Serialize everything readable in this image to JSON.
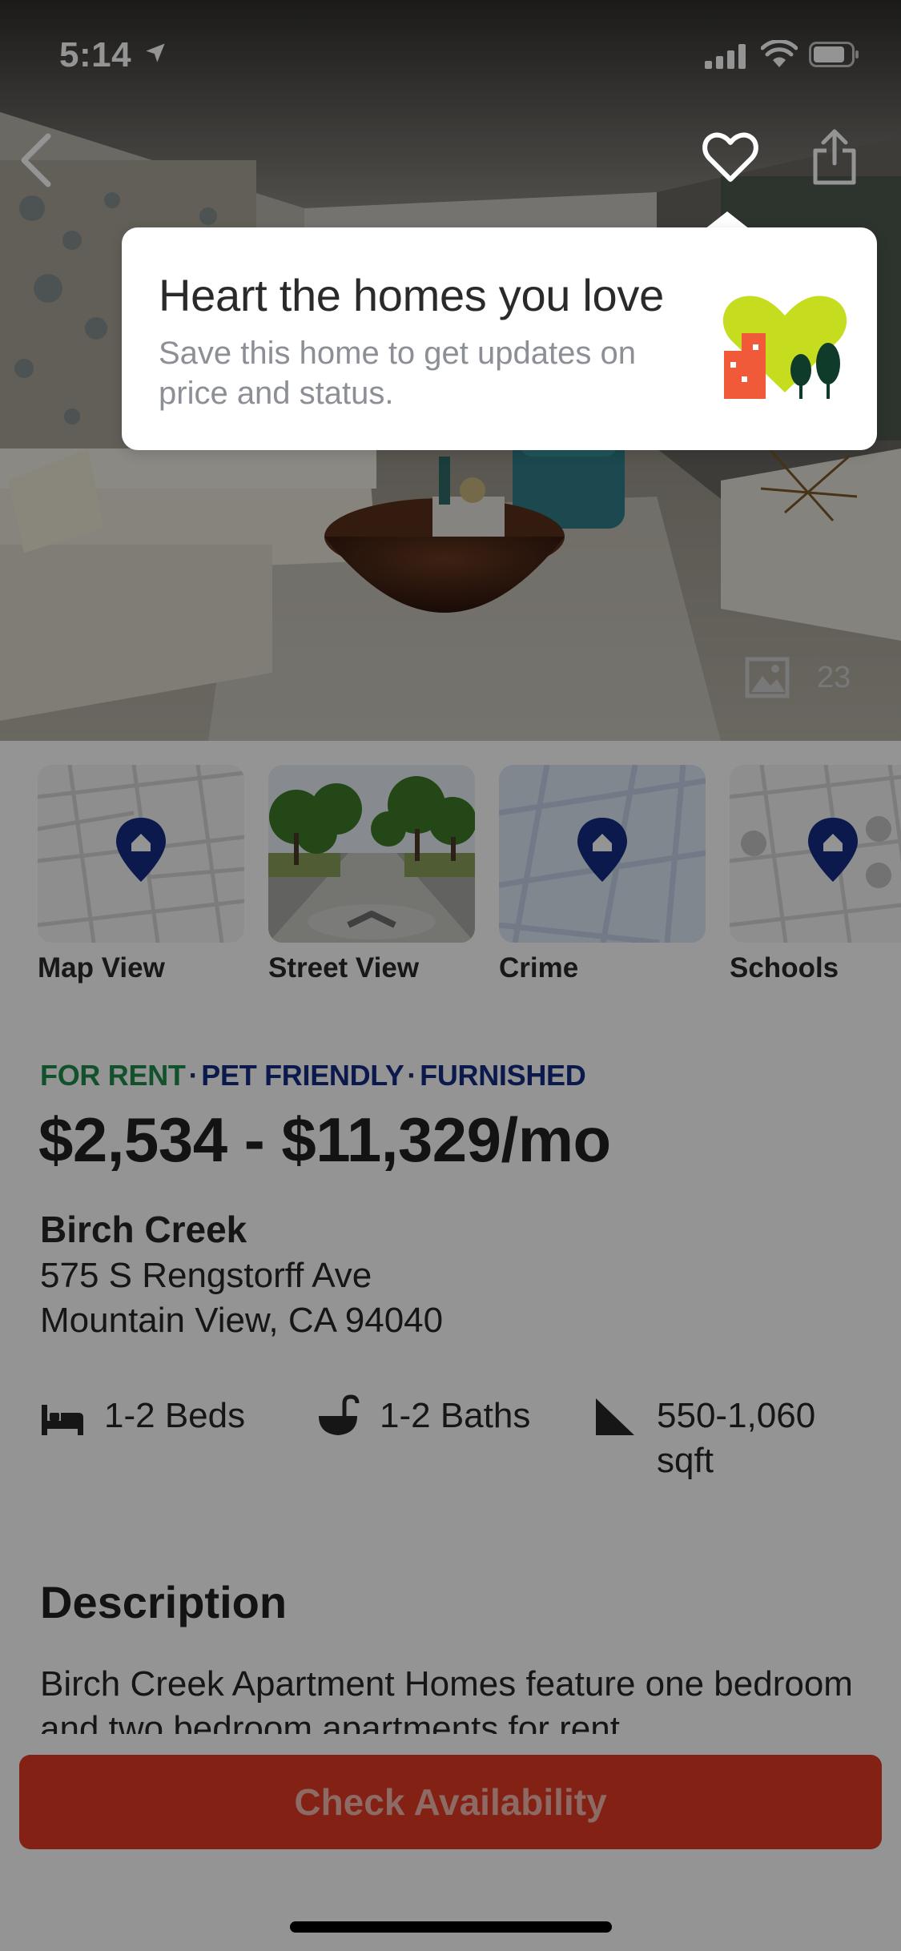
{
  "status_bar": {
    "time": "5:14"
  },
  "hero": {
    "photo_count": "23"
  },
  "tooltip": {
    "title": "Heart the homes you love",
    "body": "Save this home to get updates on price and status."
  },
  "thumbnails": [
    {
      "label": "Map View",
      "icon": "map-pin-icon"
    },
    {
      "label": "Street View",
      "icon": "street-view-icon"
    },
    {
      "label": "Crime",
      "icon": "map-pin-icon"
    },
    {
      "label": "Schools",
      "icon": "map-pin-icon"
    }
  ],
  "listing": {
    "tag_rent": "FOR RENT",
    "tag_pet": "PET FRIENDLY",
    "tag_furnished": "FURNISHED",
    "price": "$2,534 - $11,329/mo",
    "name": "Birch Creek",
    "address_line1": "575 S Rengstorff Ave",
    "address_line2": "Mountain View, CA 94040",
    "beds": "1-2 Beds",
    "baths": "1-2 Baths",
    "sqft_line1": "550-1,060",
    "sqft_line2": "sqft"
  },
  "description": {
    "heading": "Description",
    "text": "Birch Creek Apartment Homes feature one bedroom and two bedroom apartments for rent"
  },
  "cta": {
    "label": "Check Availability"
  },
  "colors": {
    "cta": "#e03a24",
    "for_rent": "#1e8c4a",
    "tag_blue": "#132c86",
    "pin": "#132c86"
  }
}
